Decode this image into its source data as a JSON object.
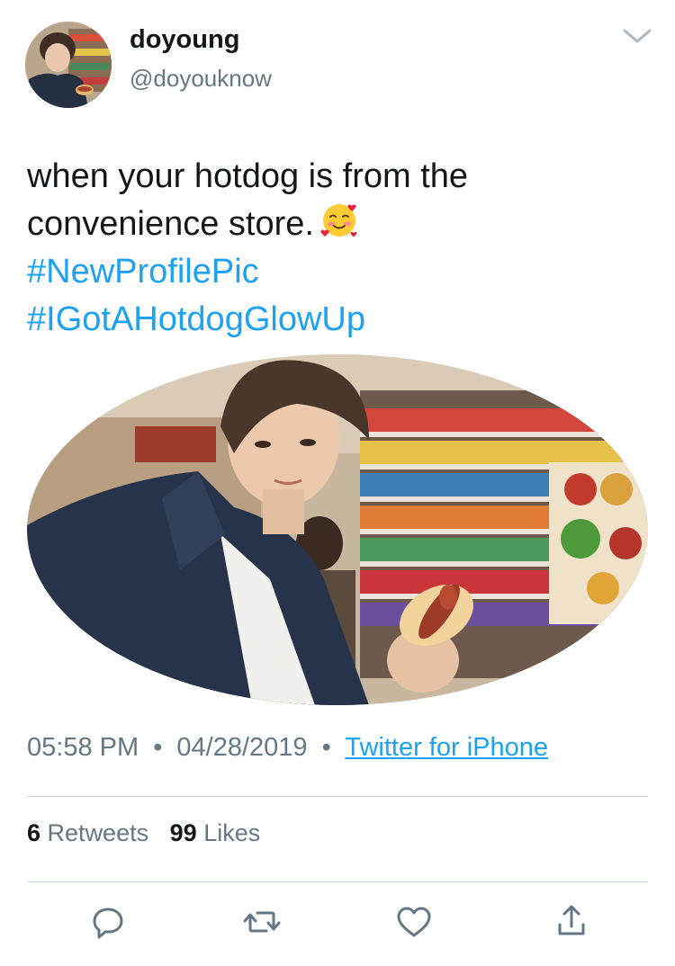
{
  "tweet": {
    "display_name": "doyoung",
    "handle": "@doyouknow",
    "text_line1": "when your hotdog is from the",
    "text_line2": "convenience store.",
    "emoji": "smiling-face-with-hearts",
    "hashtag1": "#NewProfilePic",
    "hashtag2": "#IGotAHotdogGlowUp"
  },
  "meta": {
    "time": "05:58 PM",
    "separator": "•",
    "date": "04/28/2019",
    "source": "Twitter for iPhone"
  },
  "stats": {
    "retweets_count": "6",
    "retweets_label": "Retweets",
    "likes_count": "99",
    "likes_label": "Likes"
  },
  "actions": [
    "reply-icon",
    "retweet-icon",
    "like-icon",
    "share-icon"
  ],
  "colors": {
    "link": "#1da1f2",
    "secondary_text": "#657786",
    "primary_text": "#14171a",
    "divider": "#ccd6dd",
    "icon": "#657786"
  }
}
